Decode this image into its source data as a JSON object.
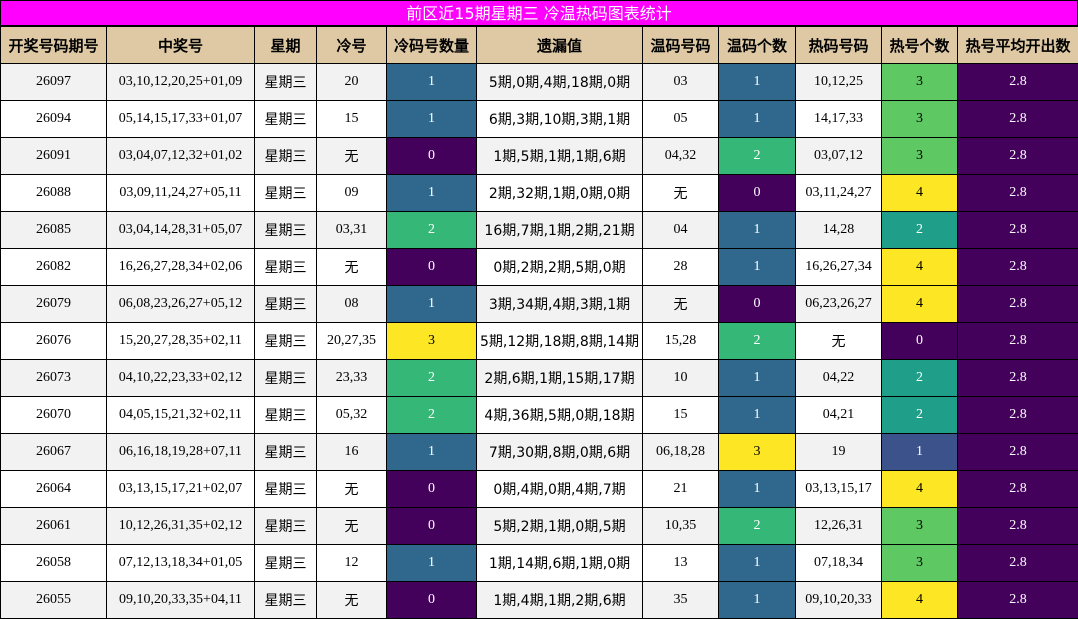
{
  "title": "前区近15期星期三 冷温热码图表统计",
  "colors": {
    "title_bg": "#ff00ff",
    "header_bg": "#dec9a4",
    "count_0": "#44015b",
    "count_1": "#30678d",
    "count_2_cold": "#35b778",
    "count_3_cold": "#fde724",
    "hot_2": "#1f9e89",
    "hot_3": "#5ec962",
    "hot_4": "#fde724",
    "hot_1": "#3b528b",
    "avg_bg": "#44015b"
  },
  "headers": [
    "开奖号码期号",
    "中奖号",
    "星期",
    "冷号",
    "冷码号数量",
    "遗漏值",
    "温码号码",
    "温码个数",
    "热码号码",
    "热号个数",
    "热号平均开出数"
  ],
  "rows": [
    [
      "26097",
      "03,10,12,20,25+01,09",
      "星期三",
      "20",
      "1",
      "5期,0期,4期,18期,0期",
      "03",
      "1",
      "10,12,25",
      "3",
      "2.8"
    ],
    [
      "26094",
      "05,14,15,17,33+01,07",
      "星期三",
      "15",
      "1",
      "6期,3期,10期,3期,1期",
      "05",
      "1",
      "14,17,33",
      "3",
      "2.8"
    ],
    [
      "26091",
      "03,04,07,12,32+01,02",
      "星期三",
      "无",
      "0",
      "1期,5期,1期,1期,6期",
      "04,32",
      "2",
      "03,07,12",
      "3",
      "2.8"
    ],
    [
      "26088",
      "03,09,11,24,27+05,11",
      "星期三",
      "09",
      "1",
      "2期,32期,1期,0期,0期",
      "无",
      "0",
      "03,11,24,27",
      "4",
      "2.8"
    ],
    [
      "26085",
      "03,04,14,28,31+05,07",
      "星期三",
      "03,31",
      "2",
      "16期,7期,1期,2期,21期",
      "04",
      "1",
      "14,28",
      "2",
      "2.8"
    ],
    [
      "26082",
      "16,26,27,28,34+02,06",
      "星期三",
      "无",
      "0",
      "0期,2期,2期,5期,0期",
      "28",
      "1",
      "16,26,27,34",
      "4",
      "2.8"
    ],
    [
      "26079",
      "06,08,23,26,27+05,12",
      "星期三",
      "08",
      "1",
      "3期,34期,4期,3期,1期",
      "无",
      "0",
      "06,23,26,27",
      "4",
      "2.8"
    ],
    [
      "26076",
      "15,20,27,28,35+02,11",
      "星期三",
      "20,27,35",
      "3",
      "5期,12期,18期,8期,14期",
      "15,28",
      "2",
      "无",
      "0",
      "2.8"
    ],
    [
      "26073",
      "04,10,22,23,33+02,12",
      "星期三",
      "23,33",
      "2",
      "2期,6期,1期,15期,17期",
      "10",
      "1",
      "04,22",
      "2",
      "2.8"
    ],
    [
      "26070",
      "04,05,15,21,32+02,11",
      "星期三",
      "05,32",
      "2",
      "4期,36期,5期,0期,18期",
      "15",
      "1",
      "04,21",
      "2",
      "2.8"
    ],
    [
      "26067",
      "06,16,18,19,28+07,11",
      "星期三",
      "16",
      "1",
      "7期,30期,8期,0期,6期",
      "06,18,28",
      "3",
      "19",
      "1",
      "2.8"
    ],
    [
      "26064",
      "03,13,15,17,21+02,07",
      "星期三",
      "无",
      "0",
      "0期,4期,0期,4期,7期",
      "21",
      "1",
      "03,13,15,17",
      "4",
      "2.8"
    ],
    [
      "26061",
      "10,12,26,31,35+02,12",
      "星期三",
      "无",
      "0",
      "5期,2期,1期,0期,5期",
      "10,35",
      "2",
      "12,26,31",
      "3",
      "2.8"
    ],
    [
      "26058",
      "07,12,13,18,34+01,05",
      "星期三",
      "12",
      "1",
      "1期,14期,6期,1期,0期",
      "13",
      "1",
      "07,18,34",
      "3",
      "2.8"
    ],
    [
      "26055",
      "09,10,20,33,35+04,11",
      "星期三",
      "无",
      "0",
      "1期,4期,1期,2期,6期",
      "35",
      "1",
      "09,10,20,33",
      "4",
      "2.8"
    ]
  ]
}
